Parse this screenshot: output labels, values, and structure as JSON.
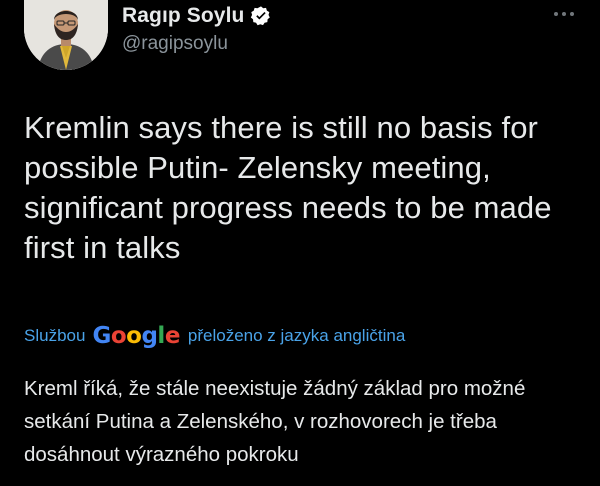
{
  "author": {
    "name": "Ragıp Soylu",
    "handle": "@ragipsoylu",
    "avatar_icon": "profile-photo",
    "verified_icon": "verified-badge-icon"
  },
  "tweet": {
    "text": "Kremlin says there is still no basis for possible Putin- Zelensky meeting, significant progress needs to be made first in talks"
  },
  "translation": {
    "prefix": "Službou",
    "provider_letters": [
      "G",
      "o",
      "o",
      "g",
      "l",
      "e"
    ],
    "provider_colors": [
      "#4285F4",
      "#EA4335",
      "#FBBC05",
      "#4285F4",
      "#34A853",
      "#EA4335"
    ],
    "suffix": "přeloženo z jazyka angličtina",
    "text": "Kreml říká, že stále neexistuje žádný základ pro možné setkání Putina a Zelenského, v rozhovorech je třeba dosáhnout výrazného pokroku"
  },
  "colors": {
    "background": "#000000",
    "text_primary": "#e7e9ea",
    "text_secondary": "#8b949b",
    "link": "#4aa3e8"
  },
  "more_icon": "more-horizontal-icon"
}
